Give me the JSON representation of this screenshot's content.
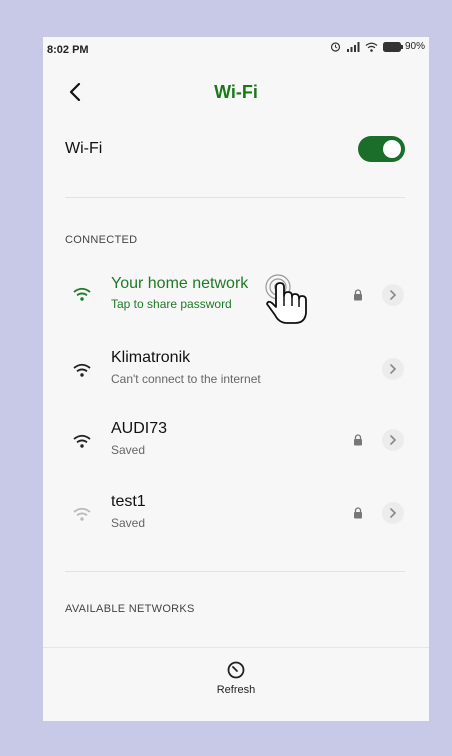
{
  "status_bar": {
    "time": "8:02 PM",
    "battery": "90%",
    "icons": [
      "alarm-icon",
      "signal-icon",
      "wifi-icon",
      "battery-icon"
    ]
  },
  "header": {
    "title": "Wi-Fi",
    "back_icon": "back-arrow-icon"
  },
  "wifi_toggle": {
    "label": "Wi-Fi",
    "state": "on"
  },
  "sections": {
    "connected": "CONNECTED",
    "available": "AVAILABLE NETWORKS"
  },
  "networks": [
    {
      "name": "Your home network",
      "status": "Tap to share password",
      "locked": true,
      "connected": true,
      "signal": "strong"
    },
    {
      "name": "Klimatronik",
      "status": "Can't connect to the internet",
      "locked": false,
      "connected": false,
      "signal": "strong"
    },
    {
      "name": "AUDI73",
      "status": "Saved",
      "locked": true,
      "connected": false,
      "signal": "strong"
    },
    {
      "name": "test1",
      "status": "Saved",
      "locked": true,
      "connected": false,
      "signal": "weak"
    }
  ],
  "bottom_bar": {
    "refresh_label": "Refresh",
    "refresh_icon": "refresh-icon"
  },
  "colors": {
    "accent": "#1b6e2a",
    "title": "#1a7a1a",
    "connected_text": "#1f7a26",
    "background": "#c7c9e6",
    "screen": "#f7f7f7"
  }
}
